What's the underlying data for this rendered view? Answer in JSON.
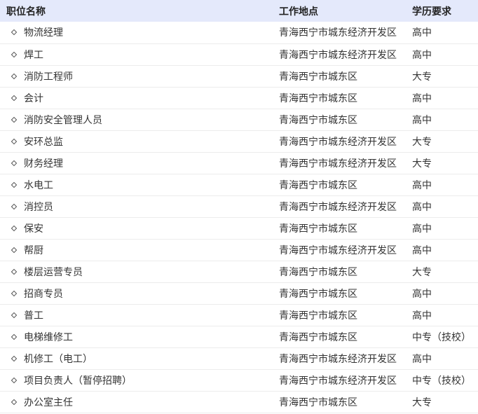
{
  "table": {
    "headers": {
      "name": "职位名称",
      "location": "工作地点",
      "education": "学历要求"
    },
    "bullet_icon": "diamond-outline-icon",
    "rows": [
      {
        "name": "物流经理",
        "location": "青海西宁市城东经济开发区",
        "education": "高中"
      },
      {
        "name": "焊工",
        "location": "青海西宁市城东经济开发区",
        "education": "高中"
      },
      {
        "name": "消防工程师",
        "location": "青海西宁市城东区",
        "education": "大专"
      },
      {
        "name": "会计",
        "location": "青海西宁市城东区",
        "education": "高中"
      },
      {
        "name": "消防安全管理人员",
        "location": "青海西宁市城东区",
        "education": "高中"
      },
      {
        "name": "安环总监",
        "location": "青海西宁市城东经济开发区",
        "education": "大专"
      },
      {
        "name": "财务经理",
        "location": "青海西宁市城东经济开发区",
        "education": "大专"
      },
      {
        "name": "水电工",
        "location": "青海西宁市城东区",
        "education": "高中"
      },
      {
        "name": "消控员",
        "location": "青海西宁市城东经济开发区",
        "education": "高中"
      },
      {
        "name": "保安",
        "location": "青海西宁市城东区",
        "education": "高中"
      },
      {
        "name": "帮厨",
        "location": "青海西宁市城东经济开发区",
        "education": "高中"
      },
      {
        "name": "楼层运营专员",
        "location": "青海西宁市城东区",
        "education": "大专"
      },
      {
        "name": "招商专员",
        "location": "青海西宁市城东区",
        "education": "高中"
      },
      {
        "name": "普工",
        "location": "青海西宁市城东区",
        "education": "高中"
      },
      {
        "name": "电梯维修工",
        "location": "青海西宁市城东区",
        "education": "中专（技校）"
      },
      {
        "name": "机修工（电工）",
        "location": "青海西宁市城东经济开发区",
        "education": "高中"
      },
      {
        "name": "项目负责人（暂停招聘）",
        "location": "青海西宁市城东经济开发区",
        "education": "中专（技校）"
      },
      {
        "name": "办公室主任",
        "location": "青海西宁市城东区",
        "education": "大专"
      }
    ]
  }
}
